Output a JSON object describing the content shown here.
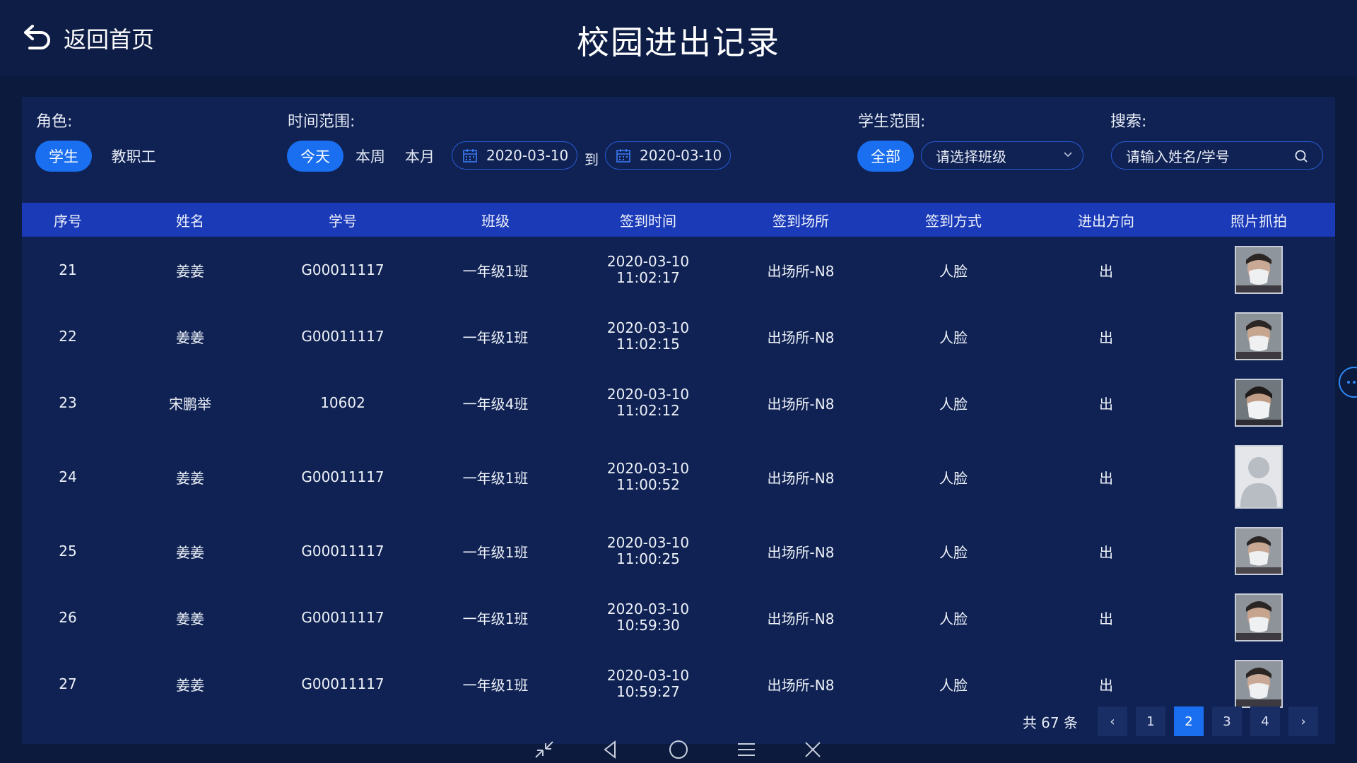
{
  "header": {
    "back_label": "返回首页",
    "title": "校园进出记录"
  },
  "filters": {
    "role_label": "角色:",
    "role_options": [
      "学生",
      "教职工"
    ],
    "time_label": "时间范围:",
    "time_options": [
      "今天",
      "本周",
      "本月"
    ],
    "date_from": "2020-03-10",
    "to_label": "到",
    "date_to": "2020-03-10",
    "scope_label": "学生范围:",
    "scope_all": "全部",
    "class_select": "请选择班级",
    "search_label": "搜索:",
    "search_placeholder": "请输入姓名/学号"
  },
  "table": {
    "columns": [
      "序号",
      "姓名",
      "学号",
      "班级",
      "签到时间",
      "签到场所",
      "签到方式",
      "进出方向",
      "照片抓拍"
    ],
    "rows": [
      {
        "no": "21",
        "name": "姜姜",
        "id": "G00011117",
        "cls": "一年级1班",
        "date": "2020-03-10",
        "time": "11:02:17",
        "place": "出场所-N8",
        "method": "人脸",
        "dir": "出",
        "photo": "face"
      },
      {
        "no": "22",
        "name": "姜姜",
        "id": "G00011117",
        "cls": "一年级1班",
        "date": "2020-03-10",
        "time": "11:02:15",
        "place": "出场所-N8",
        "method": "人脸",
        "dir": "出",
        "photo": "face"
      },
      {
        "no": "23",
        "name": "宋鹏举",
        "id": "10602",
        "cls": "一年级4班",
        "date": "2020-03-10",
        "time": "11:02:12",
        "place": "出场所-N8",
        "method": "人脸",
        "dir": "出",
        "photo": "face"
      },
      {
        "no": "24",
        "name": "姜姜",
        "id": "G00011117",
        "cls": "一年级1班",
        "date": "2020-03-10",
        "time": "11:00:52",
        "place": "出场所-N8",
        "method": "人脸",
        "dir": "出",
        "photo": "placeholder"
      },
      {
        "no": "25",
        "name": "姜姜",
        "id": "G00011117",
        "cls": "一年级1班",
        "date": "2020-03-10",
        "time": "11:00:25",
        "place": "出场所-N8",
        "method": "人脸",
        "dir": "出",
        "photo": "face"
      },
      {
        "no": "26",
        "name": "姜姜",
        "id": "G00011117",
        "cls": "一年级1班",
        "date": "2020-03-10",
        "time": "10:59:30",
        "place": "出场所-N8",
        "method": "人脸",
        "dir": "出",
        "photo": "face"
      },
      {
        "no": "27",
        "name": "姜姜",
        "id": "G00011117",
        "cls": "一年级1班",
        "date": "2020-03-10",
        "time": "10:59:27",
        "place": "出场所-N8",
        "method": "人脸",
        "dir": "出",
        "photo": "face"
      }
    ]
  },
  "pagination": {
    "total": "共 67 条",
    "prev": "‹",
    "pages": [
      "1",
      "2",
      "3",
      "4"
    ],
    "current": "2",
    "next": "›"
  },
  "nav_icons": [
    "collapse-icon",
    "back-triangle-icon",
    "home-circle-icon",
    "menu-icon",
    "close-icon"
  ],
  "colors": {
    "accent": "#1a6ff0",
    "header_row": "#1a3ab8",
    "panel": "#0f2253",
    "background": "#0b1a3d"
  }
}
